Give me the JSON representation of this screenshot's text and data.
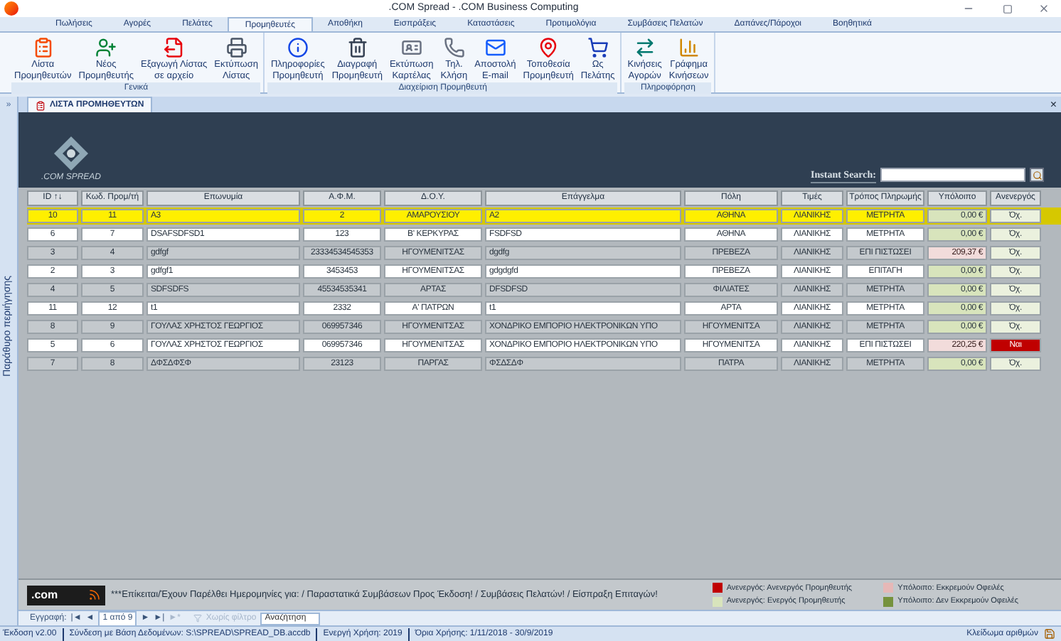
{
  "window": {
    "title": ".COM Spread - .COM Business Computing"
  },
  "tabs": [
    {
      "label": "Πωλήσεις",
      "selected": false
    },
    {
      "label": "Αγορές",
      "selected": false
    },
    {
      "label": "Πελάτες",
      "selected": false
    },
    {
      "label": "Προμηθευτές",
      "selected": true
    },
    {
      "label": "Αποθήκη",
      "selected": false
    },
    {
      "label": "Εισπράξεις",
      "selected": false
    },
    {
      "label": "Καταστάσεις",
      "selected": false
    },
    {
      "label": "Προτιμολόγια",
      "selected": false
    },
    {
      "label": "Συμβάσεις Πελατών",
      "selected": false
    },
    {
      "label": "Δαπάνες/Πάροχοι",
      "selected": false
    },
    {
      "label": "Βοηθητικά",
      "selected": false
    }
  ],
  "ribbon_groups": [
    {
      "label": "Γενικά",
      "buttons": [
        {
          "kind": "list",
          "line_1": "Λίστα",
          "line_2": "Προμηθευτών"
        },
        {
          "kind": "add",
          "line_1": "Νέος",
          "line_2": "Προμηθευτής"
        },
        {
          "kind": "export",
          "line_1": "Εξαγωγή Λίστας",
          "line_2": "σε αρχείο"
        },
        {
          "kind": "print",
          "line_1": "Εκτύπωση",
          "line_2": "Λίστας"
        }
      ]
    },
    {
      "label": "Διαχείριση Προμηθευτή",
      "buttons": [
        {
          "kind": "info",
          "line_1": "Πληροφορίες",
          "line_2": "Προμηθευτή"
        },
        {
          "kind": "delete",
          "line_1": "Διαγραφή",
          "line_2": "Προμηθευτή"
        },
        {
          "kind": "card",
          "line_1": "Εκτύπωση",
          "line_2": "Καρτέλας"
        },
        {
          "kind": "phone",
          "line_1": "Τηλ.",
          "line_2": "Κλήση"
        },
        {
          "kind": "mail",
          "line_1": "Αποστολή",
          "line_2": "E-mail"
        },
        {
          "kind": "map",
          "line_1": "Τοποθεσία",
          "line_2": "Προμηθευτή"
        },
        {
          "kind": "customer",
          "line_1": "Ως",
          "line_2": "Πελάτης"
        }
      ]
    },
    {
      "label": "Πληροφόρηση",
      "buttons": [
        {
          "kind": "moves",
          "line_1": "Κινήσεις",
          "line_2": "Αγορών"
        },
        {
          "kind": "chart",
          "line_1": "Γράφημα",
          "line_2": "Κινήσεων"
        }
      ]
    }
  ],
  "nav_pane": {
    "label": "Παράθυρο περιήγησης",
    "toggle": "»"
  },
  "document_tab": {
    "title": "ΛΙΣΤΑ ΠΡΟΜΗΘΕΥΤΩΝ",
    "close": "×"
  },
  "form": {
    "logo_text": ".COM SPREAD",
    "search_label": "Instant Search:"
  },
  "table": {
    "columns": [
      "ID ↑↓",
      "Κωδ. Προμ/τή",
      "Επωνυμία",
      "Α.Φ.Μ.",
      "Δ.Ο.Υ.",
      "Επάγγελμα",
      "Πόλη",
      "Τιμές",
      "Τρόπος Πληρωμής",
      "Υπόλοιπο",
      "Ανενεργός"
    ],
    "rows": [
      {
        "selected": true,
        "owes": false,
        "inactive": false,
        "cells": [
          "10",
          "11",
          "A3",
          "2",
          "ΑΜΑΡΟΥΣΙΟΥ",
          "A2",
          "ΑΘΗΝΑ",
          "ΛΙΑΝΙΚΗΣ",
          "ΜΕΤΡΗΤΑ",
          "0,00 €",
          "Όχ."
        ]
      },
      {
        "selected": false,
        "owes": false,
        "inactive": false,
        "cells": [
          "6",
          "7",
          "DSAFSDFSD1",
          "123",
          "Β' ΚΕΡΚΥΡΑΣ",
          "FSDFSD",
          "ΑΘΗΝΑ",
          "ΛΙΑΝΙΚΗΣ",
          "ΜΕΤΡΗΤΑ",
          "0,00 €",
          "Όχ."
        ]
      },
      {
        "selected": false,
        "owes": true,
        "inactive": false,
        "cells": [
          "3",
          "4",
          "gdfgf",
          "23334534545353",
          "ΗΓΟΥΜΕΝΙΤΣΑΣ",
          "dgdfg",
          "ΠΡΕΒΕΖΑ",
          "ΛΙΑΝΙΚΗΣ",
          "ΕΠΙ ΠΙΣΤΩΣΕΙ",
          "209,37 €",
          "Όχ."
        ]
      },
      {
        "selected": false,
        "owes": false,
        "inactive": false,
        "cells": [
          "2",
          "3",
          "gdfgf1",
          "3453453",
          "ΗΓΟΥΜΕΝΙΤΣΑΣ",
          "gdgdgfd",
          "ΠΡΕΒΕΖΑ",
          "ΛΙΑΝΙΚΗΣ",
          "ΕΠΙΤΑΓΗ",
          "0,00 €",
          "Όχ."
        ]
      },
      {
        "selected": false,
        "owes": false,
        "inactive": false,
        "cells": [
          "4",
          "5",
          "SDFSDFS",
          "45534535341",
          "ΑΡΤΑΣ",
          "DFSDFSD",
          "ΦΙΛΙΑΤΕΣ",
          "ΛΙΑΝΙΚΗΣ",
          "ΜΕΤΡΗΤΑ",
          "0,00 €",
          "Όχ."
        ]
      },
      {
        "selected": false,
        "owes": false,
        "inactive": false,
        "cells": [
          "11",
          "12",
          "t1",
          "2332",
          "Α' ΠΑΤΡΩΝ",
          "t1",
          "ΑΡΤΑ",
          "ΛΙΑΝΙΚΗΣ",
          "ΜΕΤΡΗΤΑ",
          "0,00 €",
          "Όχ."
        ]
      },
      {
        "selected": false,
        "owes": false,
        "inactive": false,
        "cells": [
          "8",
          "9",
          "ΓΟΥΛΑΣ  ΧΡΗΣΤΟΣ ΓΕΩΡΓΙΟΣ",
          "069957346",
          "ΗΓΟΥΜΕΝΙΤΣΑΣ",
          "ΧΟΝΔΡΙΚΟ ΕΜΠΟΡΙΟ ΗΛΕΚΤΡΟΝΙΚΩΝ ΥΠΟ",
          "ΗΓΟΥΜΕΝΙΤΣΑ",
          "ΛΙΑΝΙΚΗΣ",
          "ΜΕΤΡΗΤΑ",
          "0,00 €",
          "Όχ."
        ]
      },
      {
        "selected": false,
        "owes": true,
        "inactive": true,
        "cells": [
          "5",
          "6",
          "ΓΟΥΛΑΣ  ΧΡΗΣΤΟΣ ΓΕΩΡΓΙΟΣ",
          "069957346",
          "ΗΓΟΥΜΕΝΙΤΣΑΣ",
          "ΧΟΝΔΡΙΚΟ ΕΜΠΟΡΙΟ ΗΛΕΚΤΡΟΝΙΚΩΝ ΥΠΟ",
          "ΗΓΟΥΜΕΝΙΤΣΑ",
          "ΛΙΑΝΙΚΗΣ",
          "ΕΠΙ ΠΙΣΤΩΣΕΙ",
          "220,25 €",
          "Ναι"
        ]
      },
      {
        "selected": false,
        "owes": false,
        "inactive": false,
        "cells": [
          "7",
          "8",
          "ΔΦΣΔΦΣΦ",
          "23123",
          "ΠΑΡΓΑΣ",
          "ΦΣΔΣΔΦ",
          "ΠΑΤΡΑ",
          "ΛΙΑΝΙΚΗΣ",
          "ΜΕΤΡΗΤΑ",
          "0,00 €",
          "Όχ."
        ]
      }
    ]
  },
  "footer": {
    "logo_text": ".com",
    "notice": "***Επίκειται/Έχουν Παρέλθει Ημερομηνίες για:  / Παραστατικά Συμβάσεων Προς Έκδοση! / Συμβάσεις Πελατών! / Είσπραξη Επιταγών!",
    "legend": [
      {
        "label": "Ανενεργός: Ανενεργός Προμηθευτής",
        "color": "#c00000"
      },
      {
        "label": "Ανενεργός: Ενεργός Προμηθευτής",
        "color": "#d8e4bc"
      },
      {
        "label": "Υπόλοιπο: Εκκρεμούν Οφειλές",
        "color": "#e6b8b7"
      },
      {
        "label": "Υπόλοιπο: Δεν Εκκρεμούν Οφειλές",
        "color": "#76923c"
      }
    ]
  },
  "record_nav": {
    "label": "Εγγραφή:",
    "first": "|◄",
    "prev": "◄",
    "position": "1 από 9",
    "next": "►",
    "last": "►|",
    "new": "►*",
    "filter": "Χωρίς φίλτρο",
    "search_placeholder": "Αναζήτηση"
  },
  "status_bar": {
    "items": [
      "Έκδοση v2.00",
      "Σύνδεση με Βάση Δεδομένων: S:\\SPREAD\\SPREAD_DB.accdb",
      "Ενεργή Χρήση: 2019",
      "Όρια Χρήσης: 1/11/2018 - 30/9/2019"
    ],
    "right": "Κλείδωμα αριθμών"
  }
}
